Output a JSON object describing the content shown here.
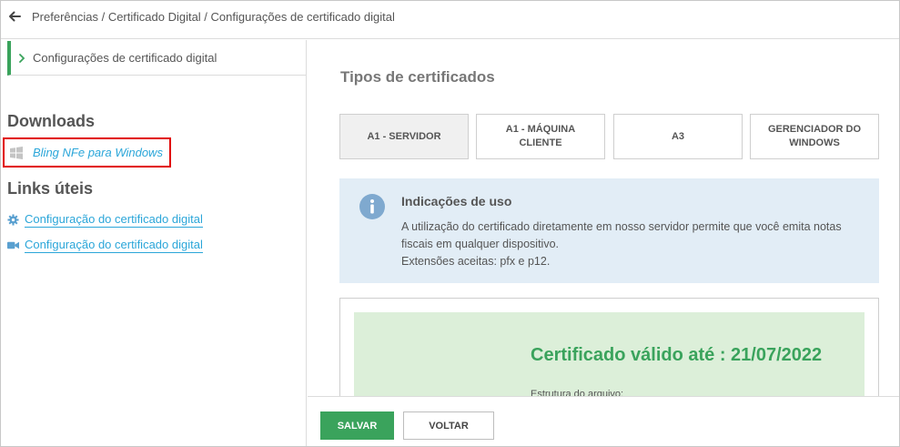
{
  "header": {
    "breadcrumb": "Preferências / Certificado Digital / Configurações de certificado digital"
  },
  "sidebar": {
    "active_item": "Configurações de certificado digital",
    "downloads_title": "Downloads",
    "download_link": "Bling NFe para Windows",
    "links_title": "Links úteis",
    "links": [
      {
        "label": "Configuração do certificado digital",
        "icon": "gear-icon"
      },
      {
        "label": "Configuração do certificado digital",
        "icon": "video-icon"
      }
    ]
  },
  "main": {
    "title": "Tipos de certificados",
    "tabs": [
      {
        "label": "A1 - SERVIDOR",
        "active": true
      },
      {
        "label": "A1 - MÁQUINA CLIENTE",
        "active": false
      },
      {
        "label": "A3",
        "active": false
      },
      {
        "label": "GERENCIADOR DO WINDOWS",
        "active": false
      }
    ],
    "info": {
      "title": "Indicações de uso",
      "line1": "A utilização do certificado diretamente em nosso servidor permite que você emita notas fiscais em qualquer dispositivo.",
      "line2": "Extensões aceitas: pfx e p12."
    },
    "certificate": {
      "title": "Certificado válido até : 21/07/2022",
      "subtitle": "Estrutura do arquivo:"
    }
  },
  "footer": {
    "save_label": "SALVAR",
    "back_label": "VOLTAR"
  },
  "colors": {
    "accent_green": "#3aa35c",
    "link_blue": "#2ba6d9",
    "highlight_red": "#e10000",
    "info_bg": "#e2edf6",
    "success_bg": "#dcefd9"
  }
}
